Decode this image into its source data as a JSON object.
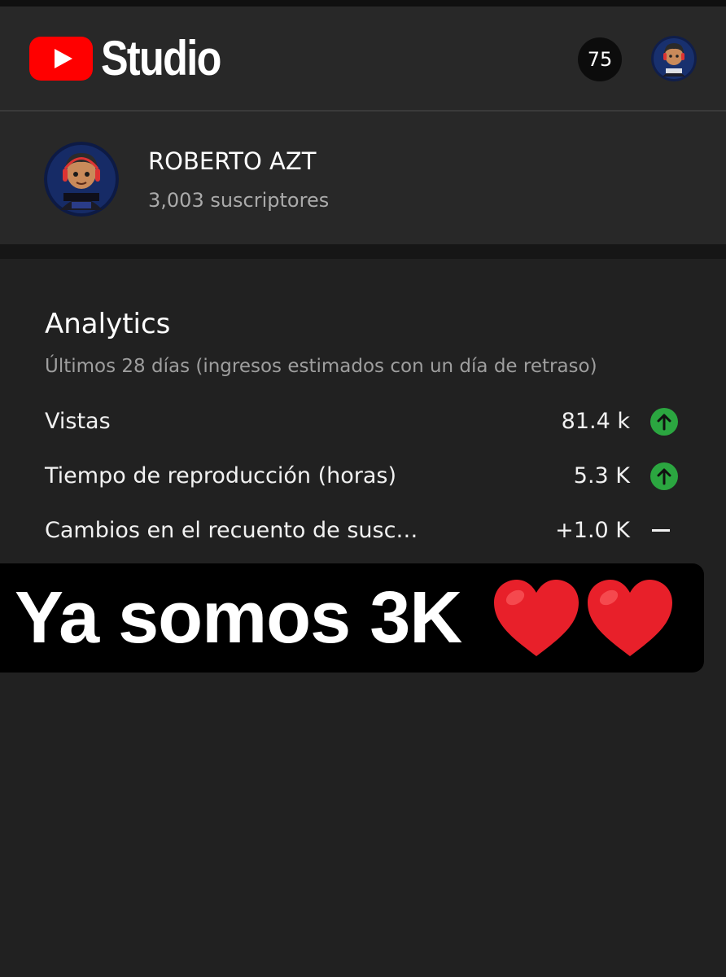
{
  "header": {
    "app_name": "Studio",
    "logo_icon": "youtube-play-icon",
    "notifications_count": "75",
    "avatar_icon": "account-avatar-icon"
  },
  "channel": {
    "name": "ROBERTO AZT",
    "subscribers": "3,003 suscriptores",
    "avatar_icon": "channel-avatar-icon"
  },
  "analytics": {
    "title": "Analytics",
    "subtitle": "Últimos 28 días (ingresos estimados con un día de retraso)",
    "metrics": [
      {
        "label": "Vistas",
        "value": "81.4 k",
        "trend_icon": "trend-up-icon"
      },
      {
        "label": "Tiempo de reproducción (horas)",
        "value": "5.3 K",
        "trend_icon": "trend-up-icon"
      },
      {
        "label": "Cambios en el recuento de susc…",
        "value": "+1.0 K",
        "trend_icon": "trend-flat-icon"
      }
    ]
  },
  "overlay": {
    "caption": "Ya somos 3K",
    "emoji_icons": [
      "red-heart-icon",
      "red-heart-icon"
    ]
  },
  "colors": {
    "youtube_red": "#ff0000",
    "trend_up_green": "#2ba640",
    "background": "#212121",
    "card": "#282828",
    "heart_red": "#e8202a"
  }
}
